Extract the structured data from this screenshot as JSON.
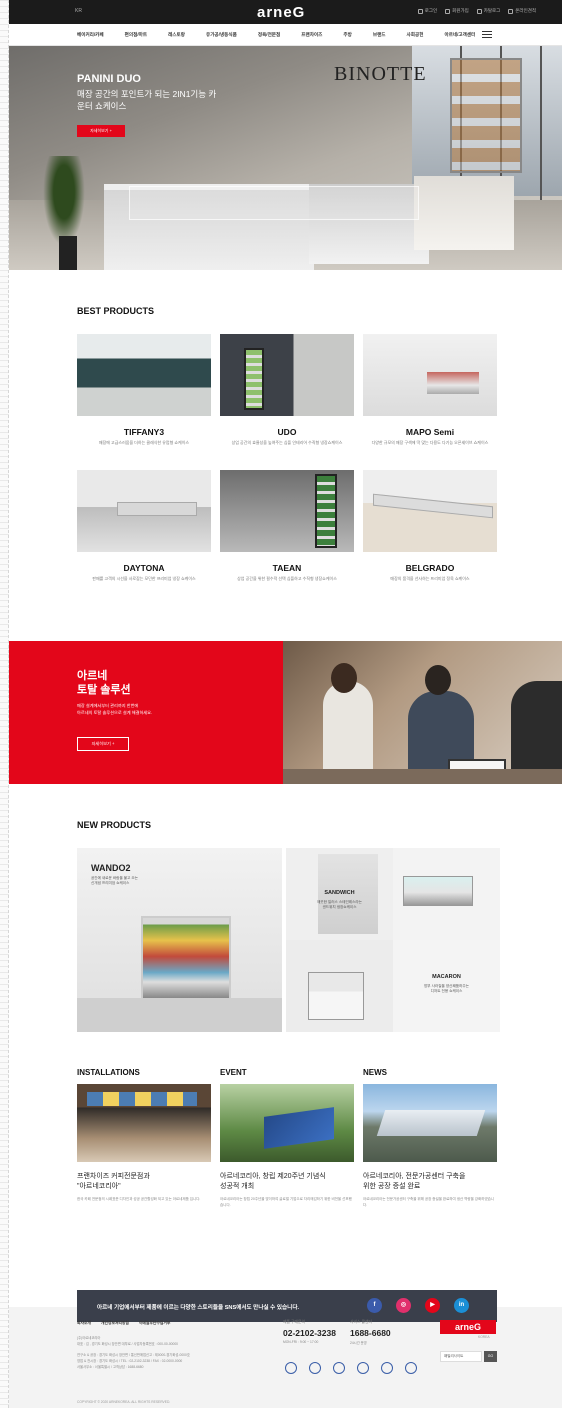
{
  "topbar": {
    "lang": "KR",
    "logo": "arneG",
    "utils": [
      "로그인",
      "회원가입",
      "카탈로그",
      "온라인견적"
    ]
  },
  "gnb": {
    "items": [
      "베이커리/카페",
      "편의점/마트",
      "레스토랑",
      "유가공/냉동식품",
      "정육/전문점",
      "프랜차이즈",
      "주방",
      "브랜드",
      "사회공헌",
      "아르네/고객센터"
    ]
  },
  "hero": {
    "title": "PANINI DUO",
    "subtitle": "매장 공간의 포인트가 되는 2IN1기능 카운터 쇼케이스",
    "button": "자세히보기 +",
    "sign": "BINOTTE"
  },
  "best": {
    "title": "BEST PRODUCTS",
    "items": [
      {
        "name": "TIFFANY3",
        "desc": "매장에 고급스러움을 더하는 클래식한 유럽형 쇼케이스"
      },
      {
        "name": "UDO",
        "desc": "상업 공간의 효율성을 높여주는 심플 인테리어 수직형 냉장쇼케이스"
      },
      {
        "name": "MAPO Semi",
        "desc": "다양한 규모의 매장 구색에 딱 맞는 다용도 다기능 오픈셰이브 쇼케이스"
      },
      {
        "name": "DAYTONA",
        "desc": "판매를 고객의 시선을 사로잡는 모던한 프리미엄 냉장 쇼케이스"
      },
      {
        "name": "TAEAN",
        "desc": "상업 공간을 위한 필수적 선택 심플하고 수직형 냉장쇼케이스"
      },
      {
        "name": "BELGRADO",
        "desc": "매장의 품격을 선사하는 프리미엄 정육 쇼케이스"
      }
    ]
  },
  "solution": {
    "title_line1": "아르네",
    "title_line2": "토탈 솔루션",
    "desc_line1": "매장 설계에서부터 관리까지 한번에",
    "desc_line2": "아르네의 토탈 솔루션으로 설계 해결하세요.",
    "button": "자세히보기  +"
  },
  "new_products": {
    "title": "NEW PRODUCTS",
    "main": {
      "name": "WANDO2",
      "desc_line1": "공간에 새로운 바람을 불고 오는",
      "desc_line2": "신개념 프리미엄 쇼케이스"
    },
    "sandwich": {
      "name": "SANDWICH",
      "desc_line1": "깨끗한 일러스 스테인레스라는",
      "desc_line2": "샌드위치 냉장쇼케이스"
    },
    "macaron": {
      "name": "MACARON",
      "desc_line1": "방부 사라질을 양산째품하주는",
      "desc_line2": "디저트 전용 쇼케이스"
    }
  },
  "news": [
    {
      "section": "INSTALLATIONS",
      "title_line1": "프랜차이즈 커피전문점과",
      "title_line2": "\"아르네코리아\"",
      "desc": "한국 카페 전문점의 시례표준 디자인과 성공 공간활성화 되고 있는 아르네제품 입니다."
    },
    {
      "section": "EVENT",
      "title_line1": "아르네코리아, 창립 제20주년 기념식",
      "title_line2": "성공적 개최",
      "desc": "아르네코리아는 창립 20주년을 맞이하여 글로벌 기업으로 자리매김하기 위한 비전을 선포했습니다."
    },
    {
      "section": "NEWS",
      "title_line1": "아르네코리아, 전문가공센터 구축을",
      "title_line2": "위한 공장 증설 완료",
      "desc": "아르네코리아는 전문가공센터 구축을 위해 공장 증설을 완료하여 생산 역량을 강화하였습니다."
    }
  ],
  "sns": {
    "text": "아르네 기업에서부터 제품에 이르는 다양한 스토리들을 SNS에서도 만나실 수 있습니다.",
    "icons": [
      "f",
      "◎",
      "▶",
      "in"
    ],
    "colors": [
      "#3b5bab",
      "#e1306c",
      "#e3061a",
      "#1b8fd6"
    ]
  },
  "footer": {
    "links": [
      "회사소개",
      "개인정보처리방침",
      "이메일무단수집거부"
    ],
    "info_line1": "(주)아르네코리아",
    "info_line2": "대표 : 김 , 경기도 화성시 장안면 대부로 / 사업자등록번호 : 000-00-00000",
    "info_line3": "연구소 & 공장 : 경기도 화성시 장안면 / 통신판매업신고 : 제0000-경기화성-0000호",
    "info_line4": "영업 & 전시장 : 경기도 화성시 / TEL : 02-2102-3238 / FAX : 02-0000-0000",
    "info_line5": "서울사무소 : 서울특별시 / 고객상담 : 1688-6680",
    "copyright": "COPYRIGHT © 2020 ARNEKOREA. ALL RIGHTS RESERVED.",
    "tel1_label": "제품 구매문의",
    "tel1": "02-2102-3238",
    "tel1_hours": "MON-FRI : 9:00 ~ 17:00",
    "tel2_label": "서비스 콜센터",
    "tel2": "1688-6680",
    "tel2_hours": "24시간 운영",
    "logo": "arneG",
    "logo_sub": "KOREA",
    "family_site": "패밀리사이트",
    "go": "GO"
  }
}
